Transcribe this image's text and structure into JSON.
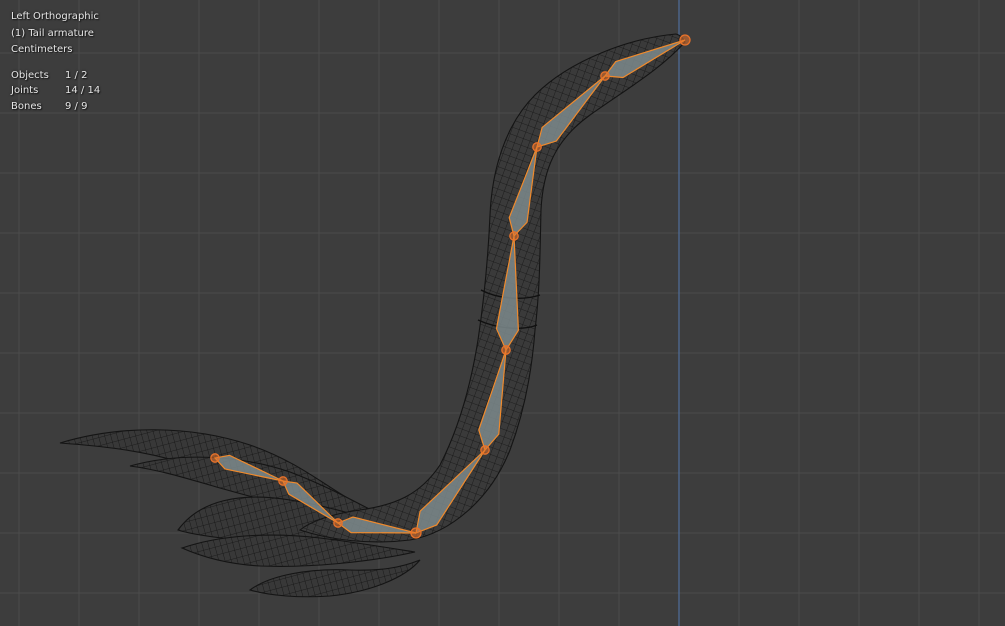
{
  "viewport": {
    "view_name": "Left Orthographic",
    "active_object": "(1) Tail armature",
    "units": "Centimeters",
    "stats": [
      {
        "label": "Objects",
        "value": "1 / 2"
      },
      {
        "label": "Joints",
        "value": "14 / 14"
      },
      {
        "label": "Bones",
        "value": "9 / 9"
      }
    ]
  },
  "colors": {
    "background": "#3d3d3d",
    "grid_line": "#4b4b4b",
    "axis_z": "#4f6e9b",
    "mesh_wire": "#141414",
    "mesh_fill": "#3a3a3a",
    "bone_fill": "#7d8a8c",
    "bone_outline": "#f08a2c",
    "joint": "#e8722a"
  }
}
